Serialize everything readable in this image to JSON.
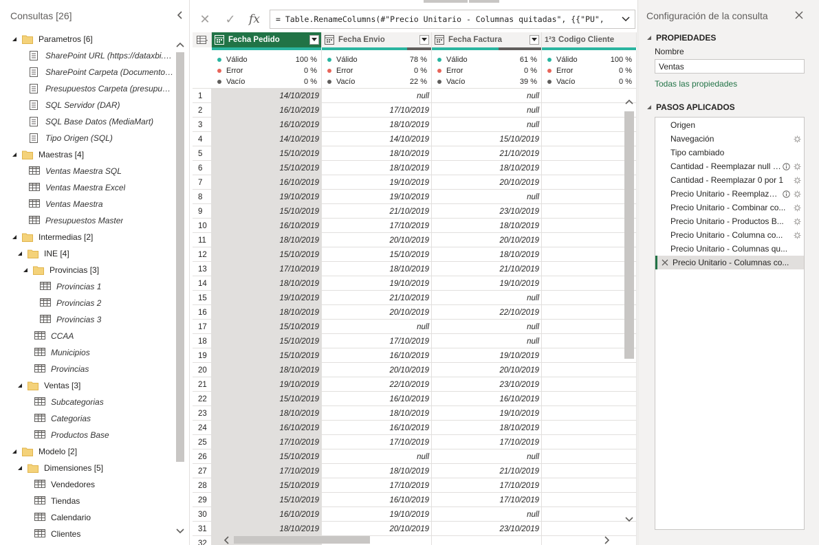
{
  "left_pane": {
    "title": "Consultas [26]",
    "tree": [
      {
        "label": "Parametros [6]",
        "kind": "folder",
        "level": 0
      },
      {
        "label": "SharePoint URL (https://dataxbi.sha...",
        "kind": "param",
        "level": 1
      },
      {
        "label": "SharePoint Carpeta (Documentos c...",
        "kind": "param",
        "level": 1
      },
      {
        "label": "Presupuestos Carpeta (presupuestos)",
        "kind": "param",
        "level": 1
      },
      {
        "label": "SQL Servidor (DAR)",
        "kind": "param",
        "level": 1
      },
      {
        "label": "SQL Base Datos (MediaMart)",
        "kind": "param",
        "level": 1
      },
      {
        "label": "Tipo Origen (SQL)",
        "kind": "param",
        "level": 1
      },
      {
        "label": "Maestras [4]",
        "kind": "folder",
        "level": 0
      },
      {
        "label": "Ventas Maestra SQL",
        "kind": "table",
        "level": 1
      },
      {
        "label": "Ventas Maestra Excel",
        "kind": "table",
        "level": 1
      },
      {
        "label": "Ventas Maestra",
        "kind": "table",
        "level": 1
      },
      {
        "label": "Presupuestos Master",
        "kind": "table",
        "level": 1
      },
      {
        "label": "Intermedias [2]",
        "kind": "folder",
        "level": 0
      },
      {
        "label": "INE [4]",
        "kind": "folder",
        "level": 1
      },
      {
        "label": "Provincias [3]",
        "kind": "folder",
        "level": 2
      },
      {
        "label": "Provincias 1",
        "kind": "table",
        "level": 3
      },
      {
        "label": "Provincias 2",
        "kind": "table",
        "level": 3
      },
      {
        "label": "Provincias 3",
        "kind": "table",
        "level": 3
      },
      {
        "label": "CCAA",
        "kind": "table",
        "level": 2
      },
      {
        "label": "Municipios",
        "kind": "table",
        "level": 2
      },
      {
        "label": "Provincias",
        "kind": "table",
        "level": 2
      },
      {
        "label": "Ventas [3]",
        "kind": "folder",
        "level": 1
      },
      {
        "label": "Subcategorias",
        "kind": "table",
        "level": 2
      },
      {
        "label": "Categorias",
        "kind": "table",
        "level": 2
      },
      {
        "label": "Productos Base",
        "kind": "table",
        "level": 2
      },
      {
        "label": "Modelo [2]",
        "kind": "folder",
        "level": 0
      },
      {
        "label": "Dimensiones [5]",
        "kind": "folder",
        "level": 1
      },
      {
        "label": "Vendedores",
        "kind": "table-plain",
        "level": 2
      },
      {
        "label": "Tiendas",
        "kind": "table-plain",
        "level": 2
      },
      {
        "label": "Calendario",
        "kind": "table-plain",
        "level": 2
      },
      {
        "label": "Clientes",
        "kind": "table-plain",
        "level": 2
      }
    ]
  },
  "formula_bar": {
    "cancel_icon": "✕",
    "ok_icon": "✓",
    "fx_label": "fx",
    "formula": "= Table.RenameColumns(#\"Precio Unitario - Columnas quitadas\", {{\"PU\","
  },
  "grid": {
    "columns": [
      {
        "name": "Fecha Pedido",
        "type_label": "",
        "type": "date",
        "selected": true,
        "valid": "100 %",
        "error": "0 %",
        "empty": "0 %",
        "quality": [
          100,
          0,
          0
        ]
      },
      {
        "name": "Fecha Envio",
        "type_label": "",
        "type": "date",
        "selected": false,
        "valid": "78 %",
        "error": "0 %",
        "empty": "22 %",
        "quality": [
          78,
          0,
          22
        ]
      },
      {
        "name": "Fecha Factura",
        "type_label": "",
        "type": "date",
        "selected": false,
        "valid": "61 %",
        "error": "0 %",
        "empty": "39 %",
        "quality": [
          61,
          0,
          39
        ]
      },
      {
        "name": "Codigo Cliente",
        "type_label": "1²3",
        "type": "number",
        "selected": false,
        "valid": "100 %",
        "error": "0 %",
        "empty": "0 %",
        "quality": [
          100,
          0,
          0
        ]
      }
    ],
    "stat_labels": {
      "valid": "Válido",
      "error": "Error",
      "empty": "Vacío"
    },
    "rows": [
      [
        "1",
        "14/10/2019",
        "null",
        "null"
      ],
      [
        "2",
        "16/10/2019",
        "17/10/2019",
        "null"
      ],
      [
        "3",
        "16/10/2019",
        "18/10/2019",
        "null"
      ],
      [
        "4",
        "14/10/2019",
        "14/10/2019",
        "15/10/2019"
      ],
      [
        "5",
        "15/10/2019",
        "18/10/2019",
        "21/10/2019"
      ],
      [
        "6",
        "15/10/2019",
        "18/10/2019",
        "18/10/2019"
      ],
      [
        "7",
        "16/10/2019",
        "19/10/2019",
        "20/10/2019"
      ],
      [
        "8",
        "19/10/2019",
        "19/10/2019",
        "null"
      ],
      [
        "9",
        "15/10/2019",
        "21/10/2019",
        "23/10/2019"
      ],
      [
        "10",
        "16/10/2019",
        "17/10/2019",
        "18/10/2019"
      ],
      [
        "11",
        "18/10/2019",
        "20/10/2019",
        "20/10/2019"
      ],
      [
        "12",
        "15/10/2019",
        "15/10/2019",
        "18/10/2019"
      ],
      [
        "13",
        "17/10/2019",
        "18/10/2019",
        "21/10/2019"
      ],
      [
        "14",
        "18/10/2019",
        "19/10/2019",
        "19/10/2019"
      ],
      [
        "15",
        "19/10/2019",
        "21/10/2019",
        "null"
      ],
      [
        "16",
        "18/10/2019",
        "20/10/2019",
        "22/10/2019"
      ],
      [
        "17",
        "15/10/2019",
        "null",
        "null"
      ],
      [
        "18",
        "15/10/2019",
        "17/10/2019",
        "null"
      ],
      [
        "19",
        "15/10/2019",
        "16/10/2019",
        "19/10/2019"
      ],
      [
        "20",
        "18/10/2019",
        "20/10/2019",
        "20/10/2019"
      ],
      [
        "21",
        "19/10/2019",
        "22/10/2019",
        "23/10/2019"
      ],
      [
        "22",
        "15/10/2019",
        "16/10/2019",
        "16/10/2019"
      ],
      [
        "23",
        "18/10/2019",
        "18/10/2019",
        "19/10/2019"
      ],
      [
        "24",
        "16/10/2019",
        "16/10/2019",
        "18/10/2019"
      ],
      [
        "25",
        "17/10/2019",
        "17/10/2019",
        "17/10/2019"
      ],
      [
        "26",
        "15/10/2019",
        "null",
        "null"
      ],
      [
        "27",
        "17/10/2019",
        "18/10/2019",
        "21/10/2019"
      ],
      [
        "28",
        "15/10/2019",
        "17/10/2019",
        "17/10/2019"
      ],
      [
        "29",
        "15/10/2019",
        "16/10/2019",
        "17/10/2019"
      ],
      [
        "30",
        "16/10/2019",
        "19/10/2019",
        "null"
      ],
      [
        "31",
        "18/10/2019",
        "20/10/2019",
        "23/10/2019"
      ],
      [
        "32",
        "",
        "",
        ""
      ]
    ]
  },
  "right_pane": {
    "title": "Configuración de la consulta",
    "properties_header": "PROPIEDADES",
    "name_label": "Nombre",
    "name_value": "Ventas",
    "all_properties_link": "Todas las propiedades",
    "steps_header": "PASOS APLICADOS",
    "steps": [
      {
        "name": "Origen",
        "info": false,
        "gear": false,
        "current": false
      },
      {
        "name": "Navegación",
        "info": false,
        "gear": true,
        "current": false
      },
      {
        "name": "Tipo cambiado",
        "info": false,
        "gear": false,
        "current": false
      },
      {
        "name": "Cantidad - Reemplazar null p...",
        "info": true,
        "gear": true,
        "current": false
      },
      {
        "name": "Cantidad - Reemplazar 0 por 1",
        "info": false,
        "gear": true,
        "current": false
      },
      {
        "name": "Precio Unitario - Reemplazar ...",
        "info": true,
        "gear": true,
        "current": false
      },
      {
        "name": "Precio Unitario - Combinar co...",
        "info": false,
        "gear": true,
        "current": false
      },
      {
        "name": "Precio Unitario - Productos B...",
        "info": false,
        "gear": true,
        "current": false
      },
      {
        "name": "Precio Unitario - Columna co...",
        "info": false,
        "gear": true,
        "current": false
      },
      {
        "name": "Precio Unitario - Columnas qu...",
        "info": false,
        "gear": false,
        "current": false
      },
      {
        "name": "Precio Unitario - Columnas co...",
        "info": false,
        "gear": false,
        "current": true
      }
    ]
  },
  "colors": {
    "accent": "#217346",
    "valid": "#2bb5a0",
    "error": "#e8655a",
    "empty": "#605e5c"
  }
}
